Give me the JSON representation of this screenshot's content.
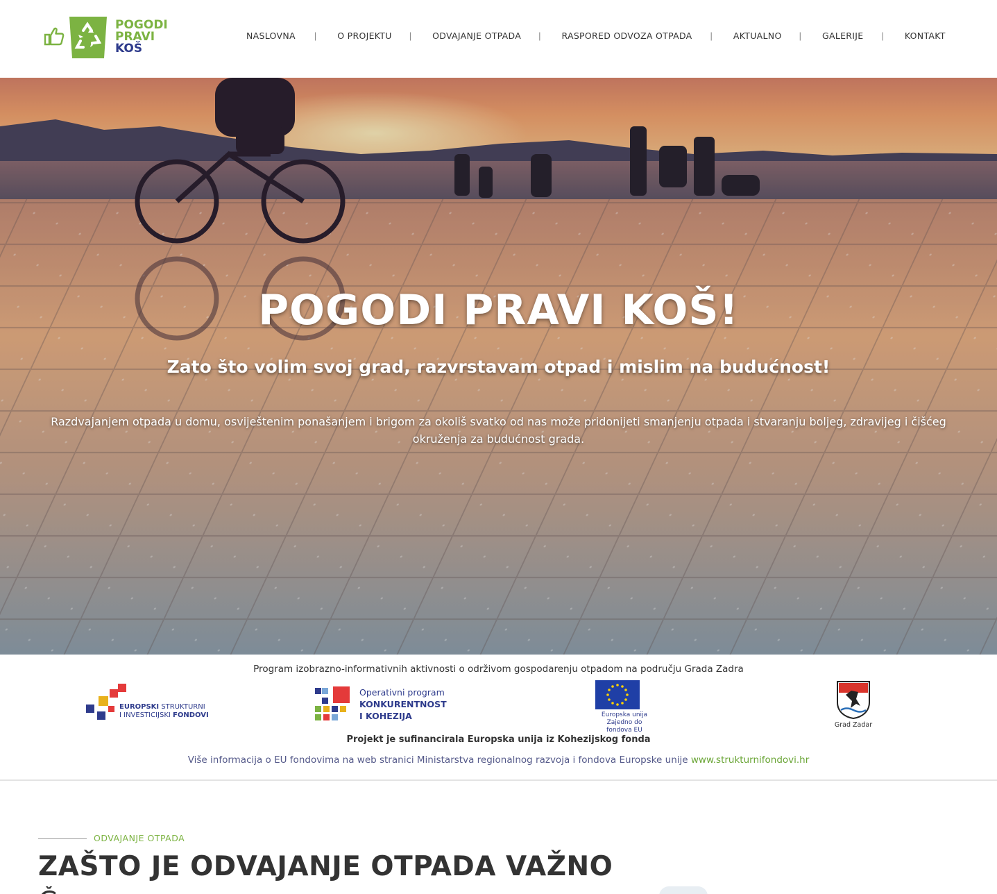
{
  "brand": {
    "logo_line1": "POGODI",
    "logo_line2": "PRAVI",
    "logo_line3": "KOŠ",
    "color_green": "#7cb342",
    "color_blue": "#2e3b8c"
  },
  "nav": {
    "items": [
      {
        "label": "NASLOVNA"
      },
      {
        "label": "O PROJEKTU"
      },
      {
        "label": "ODVAJANJE OTPADA"
      },
      {
        "label": "RASPORED ODVOZA OTPADA"
      },
      {
        "label": "AKTUALNO"
      },
      {
        "label": "GALERIJE"
      },
      {
        "label": "KONTAKT"
      }
    ],
    "separator": "|"
  },
  "hero": {
    "title": "POGODI PRAVI KOŠ!",
    "subtitle": "Zato što volim svoj grad, razvrstavam otpad i mislim na budućnost!",
    "text": "Razdvajanjem otpada u domu, osviještenim ponašanjem i brigom za okoliš svatko od nas može pridonijeti smanjenju otpada i stvaranju boljeg, zdravijeg i čišćeg okruženja za budućnost grada."
  },
  "eu_strip": {
    "program": "Program izobrazno-informativnih aktivnosti o održivom gospodarenju otpadom na području Grada Zadra",
    "esif_line1_bold": "EUROPSKI",
    "esif_line1_rest": " STRUKTURNI",
    "esif_line2_rest": "I INVESTICIJSKI ",
    "esif_line2_bold": "FONDOVI",
    "opk_line1": "Operativni program",
    "opk_line2": "KONKURENTNOST",
    "opk_line3": "I KOHEZIJA",
    "eu_caption1": "Europska unija",
    "eu_caption2": "Zajedno do fondova EU",
    "zadar_caption": "Grad Zadar",
    "cofinanced": "Projekt je sufinancirala Europska unija iz Kohezijskog fonda",
    "more_info": "Više informacija o EU fondovima na web stranici Ministarstva regionalnog razvoja i fondova Europske unije ",
    "more_link": "www.strukturnifondovi.hr"
  },
  "section": {
    "kicker": "ODVAJANJE OTPADA",
    "heading_pre": "ZAŠTO JE ",
    "heading_bold": "ODVAJANJE OTPADA",
    "heading_post": " VAŽNO",
    "heading_next": "Č"
  }
}
